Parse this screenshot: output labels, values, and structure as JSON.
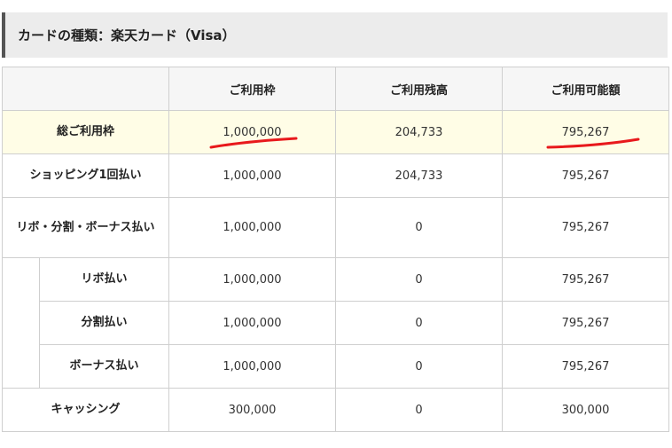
{
  "header": {
    "title": "カードの種類：楽天カード（Visa）"
  },
  "table": {
    "columns": [
      "",
      "ご利用枠",
      "ご利用残高",
      "ご利用可能額"
    ],
    "rows": [
      {
        "label": "総ご利用枠",
        "limit": "1,000,000",
        "balance": "204,733",
        "available": "795,267",
        "highlighted": true
      },
      {
        "label": "ショッピング1回払い",
        "limit": "1,000,000",
        "balance": "204,733",
        "available": "795,267"
      },
      {
        "label": "リボ・分割・ボーナス払い",
        "limit": "1,000,000",
        "balance": "0",
        "available": "795,267"
      },
      {
        "label": "リボ払い",
        "limit": "1,000,000",
        "balance": "0",
        "available": "795,267",
        "indented": true
      },
      {
        "label": "分割払い",
        "limit": "1,000,000",
        "balance": "0",
        "available": "795,267",
        "indented": true
      },
      {
        "label": "ボーナス払い",
        "limit": "1,000,000",
        "balance": "0",
        "available": "795,267",
        "indented": true
      },
      {
        "label": "キャッシング",
        "limit": "300,000",
        "balance": "0",
        "available": "300,000"
      }
    ]
  },
  "annotations": {
    "underline_color": "#e8191c"
  }
}
